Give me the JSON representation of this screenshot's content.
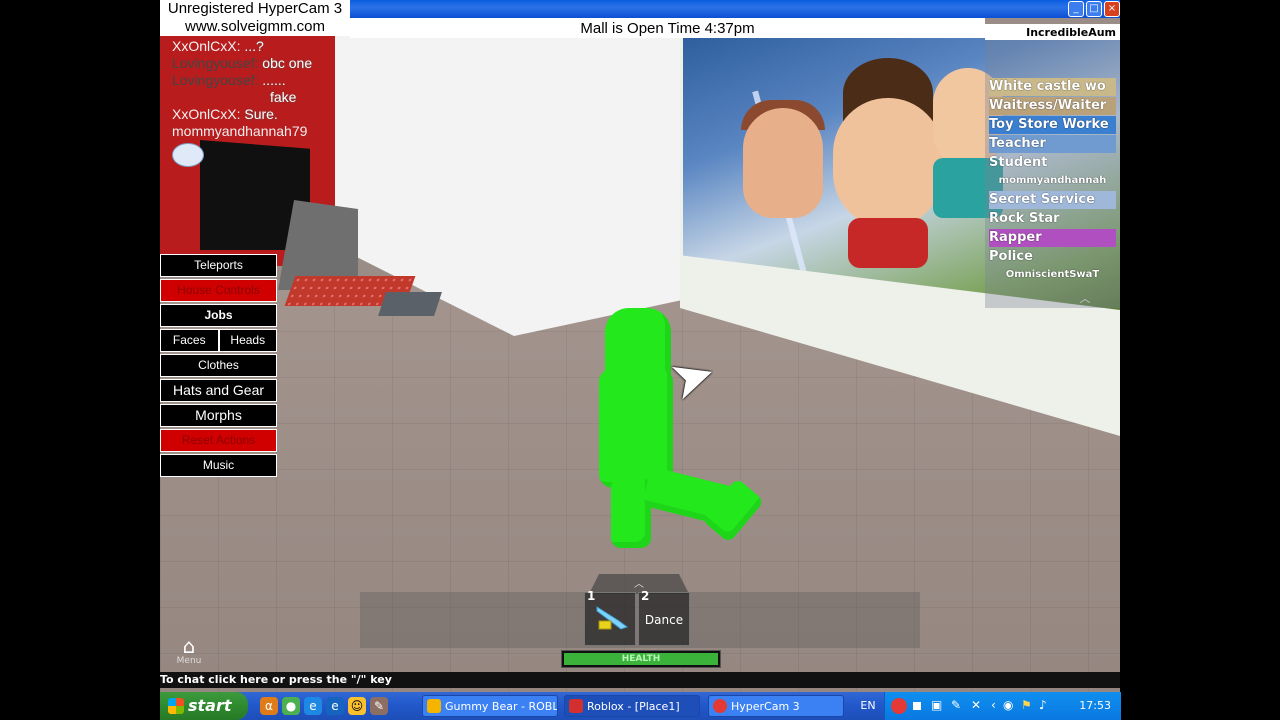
{
  "watermark": {
    "line1": "Unregistered HyperCam 3",
    "line2": "www.solveigmm.com"
  },
  "status_bar": {
    "text": "Mall is Open Time 4:37pm"
  },
  "chat": [
    {
      "name": "XxOnlCxX:",
      "message": "...?"
    },
    {
      "name": "Lovingyousef:",
      "message": "obc one"
    },
    {
      "name": "Lovingyousef:",
      "message": "......"
    },
    {
      "name": "",
      "message": "fake"
    },
    {
      "name": "XxOnlCxX:",
      "message": "Sure."
    },
    {
      "name": "mommyandhannah79",
      "message": ""
    }
  ],
  "menu": {
    "teleports": "Teleports",
    "house_controls": "House Controls",
    "jobs": "Jobs",
    "faces": "Faces",
    "heads": "Heads",
    "clothes": "Clothes",
    "hats_gear": "Hats and Gear",
    "morphs": "Morphs",
    "reset_actions": "Reset Actions",
    "music": "Music"
  },
  "jobs_panel": {
    "player": "IncredibleAum",
    "items": [
      {
        "label": "White castle wo",
        "color": "#c9b98a"
      },
      {
        "label": "Waitress/Waiter",
        "color": "#b9a27a"
      },
      {
        "label": "Toy Store Worke",
        "color": "#3b7fd0"
      },
      {
        "label": "Teacher",
        "color": "#6f9bd0"
      },
      {
        "label": "Student",
        "color": ""
      },
      {
        "label": "mommyandhannah",
        "color": "",
        "sub": true
      },
      {
        "label": "Secret Service",
        "color": "#9fb7d9"
      },
      {
        "label": "Rock Star",
        "color": ""
      },
      {
        "label": "Rapper",
        "color": "#b04fc0"
      },
      {
        "label": "Police",
        "color": ""
      },
      {
        "label": "OmniscientSwaT",
        "color": "",
        "sub": true
      }
    ]
  },
  "hotbar": {
    "slot1_num": "1",
    "slot2_num": "2",
    "slot2_label": "Dance",
    "health_label": "HEALTH",
    "health_fraction": 1.0
  },
  "home": {
    "label": "Menu"
  },
  "chat_hint": "To chat click here or press the \"/\" key",
  "taskbar": {
    "start": "start",
    "tasks": [
      {
        "label": "Gummy Bear - ROBL...",
        "icon_color": "#f4b400"
      },
      {
        "label": "Roblox - [Place1]",
        "icon_color": "#d32f2f"
      },
      {
        "label": "HyperCam 3",
        "icon_color": "#e53935"
      }
    ],
    "lang": "EN",
    "clock": "17:53"
  },
  "colors": {
    "accent_green": "#22e81c",
    "menu_red": "#d10000",
    "xp_blue": "#2157c9"
  }
}
